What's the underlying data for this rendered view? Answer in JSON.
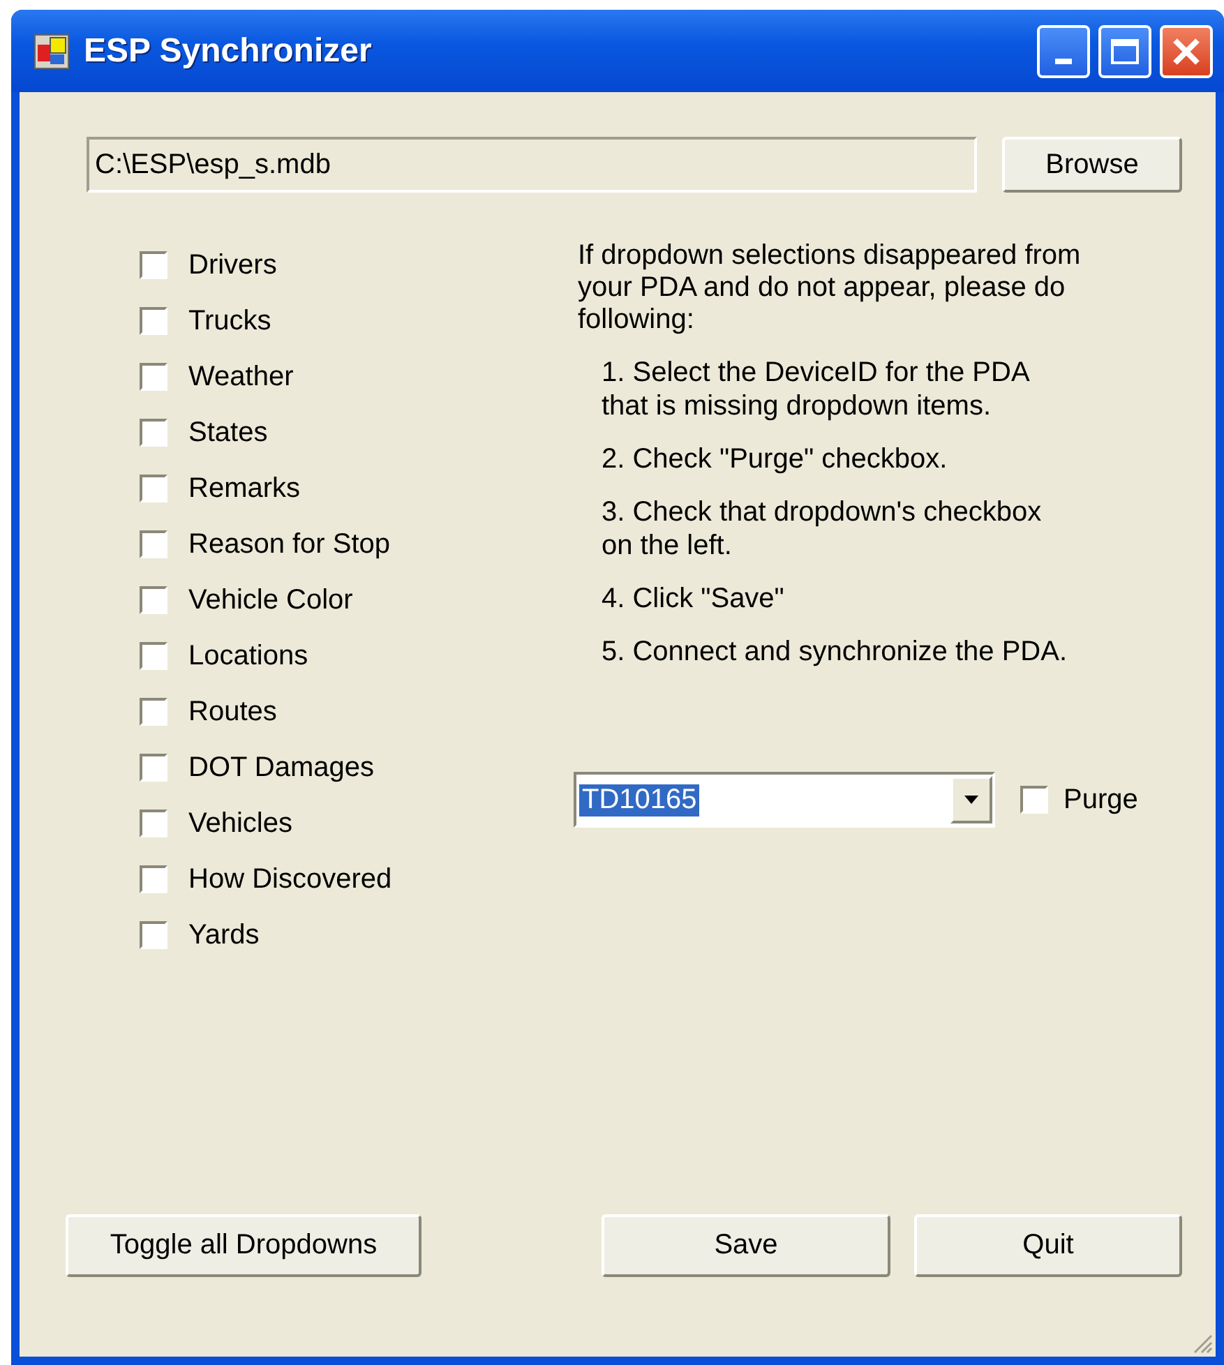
{
  "window": {
    "title": "ESP Synchronizer"
  },
  "database_path": {
    "value": "C:\\ESP\\esp_s.mdb"
  },
  "browse_button": "Browse",
  "dropdowns": [
    {
      "label": "Drivers",
      "checked": false
    },
    {
      "label": "Trucks",
      "checked": false
    },
    {
      "label": "Weather",
      "checked": false
    },
    {
      "label": "States",
      "checked": false
    },
    {
      "label": "Remarks",
      "checked": false
    },
    {
      "label": "Reason for Stop",
      "checked": false
    },
    {
      "label": "Vehicle Color",
      "checked": false
    },
    {
      "label": "Locations",
      "checked": false
    },
    {
      "label": "Routes",
      "checked": false
    },
    {
      "label": "DOT Damages",
      "checked": false
    },
    {
      "label": "Vehicles",
      "checked": false
    },
    {
      "label": "How Discovered",
      "checked": false
    },
    {
      "label": "Yards",
      "checked": false
    }
  ],
  "instructions": {
    "intro": "If dropdown selections disappeared from\nyour PDA and do not appear, please do\nfollowing:",
    "steps": [
      "1. Select the DeviceID for the PDA\nthat is missing dropdown items.",
      "2. Check \"Purge\" checkbox.",
      "3. Check that dropdown's checkbox\non the left.",
      "4. Click \"Save\"",
      "5. Connect and synchronize the PDA."
    ]
  },
  "device": {
    "value": "TD10165",
    "text_selected": true
  },
  "purge": {
    "label": "Purge",
    "checked": false
  },
  "buttons": [
    {
      "label": "Toggle all Dropdowns",
      "kind": "toggle"
    },
    {
      "label": "Save",
      "kind": "save"
    },
    {
      "label": "Quit",
      "kind": "quit"
    }
  ]
}
